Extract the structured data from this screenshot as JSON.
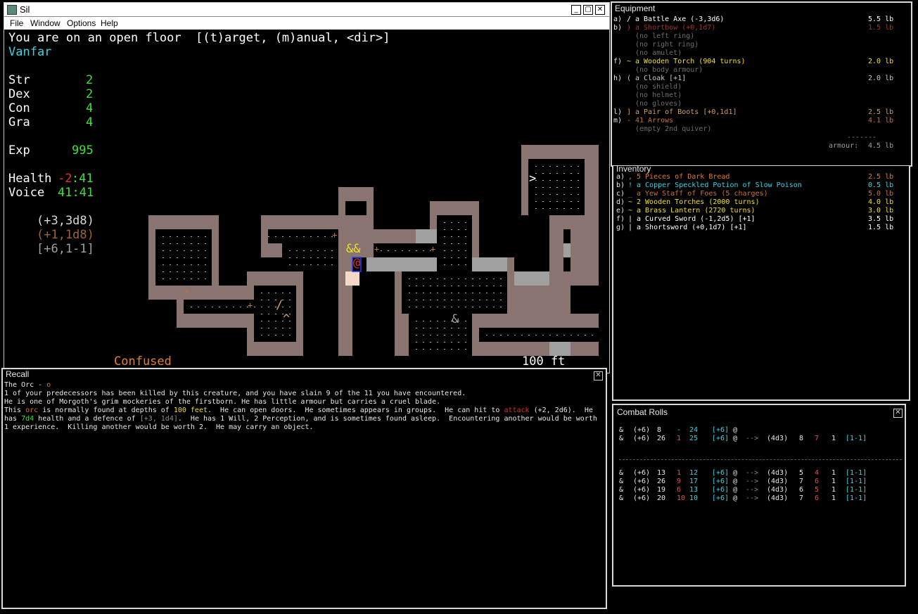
{
  "main_window": {
    "title": "Sil",
    "menu": [
      "File",
      "Window",
      "Options",
      "Help"
    ],
    "prompt": "You are on an open floor  [(t)arget, (m)anual, <dir>]",
    "character_name": "Vanfar",
    "stats": [
      {
        "label": "Str",
        "value": "2"
      },
      {
        "label": "Dex",
        "value": "2"
      },
      {
        "label": "Con",
        "value": "4"
      },
      {
        "label": "Gra",
        "value": "4"
      }
    ],
    "exp_label": "Exp",
    "exp_value": "995",
    "health_label": "Health",
    "health_current": "-2",
    "health_sep_max": ":41",
    "voice_label": "Voice",
    "voice_value": "41:41",
    "attack_melee": "(+3,3d8)",
    "attack_bow": "(+1,1d8)",
    "defence": "[+6,1-1]",
    "status": "Confused",
    "depth": "100 ft"
  },
  "equipment": {
    "title": "Equipment",
    "rows": [
      {
        "slot": "a)",
        "sym": "/",
        "name": "a Battle Axe (-3,3d6)",
        "weight": "5.5 lb",
        "color": "#ffffff"
      },
      {
        "slot": "b)",
        "sym": ")",
        "name": "a Shortbow (+0,1d7)",
        "weight": "1.5 lb",
        "color": "#9b3a2a"
      },
      {
        "slot": "",
        "sym": "",
        "name": "(no left ring)",
        "weight": "",
        "color": "#6e6e6e"
      },
      {
        "slot": "",
        "sym": "",
        "name": "(no right ring)",
        "weight": "",
        "color": "#6e6e6e"
      },
      {
        "slot": "",
        "sym": "",
        "name": "(no amulet)",
        "weight": "",
        "color": "#6e6e6e"
      },
      {
        "slot": "f)",
        "sym": "~",
        "name": "a Wooden Torch (904 turns)",
        "weight": "2.0 lb",
        "color": "#f0e020"
      },
      {
        "slot": "",
        "sym": "",
        "name": "(no body armour)",
        "weight": "",
        "color": "#6e6e6e"
      },
      {
        "slot": "h)",
        "sym": "(",
        "name": "a Cloak [+1]",
        "weight": "2.0 lb",
        "color": "#c8c8c8"
      },
      {
        "slot": "",
        "sym": "",
        "name": "(no shield)",
        "weight": "",
        "color": "#6e6e6e"
      },
      {
        "slot": "",
        "sym": "",
        "name": "(no helmet)",
        "weight": "",
        "color": "#6e6e6e"
      },
      {
        "slot": "",
        "sym": "",
        "name": "(no gloves)",
        "weight": "",
        "color": "#6e6e6e"
      },
      {
        "slot": "l)",
        "sym": "]",
        "name": "a Pair of Boots [+0,1d1]",
        "weight": "2.5 lb",
        "color": "#c8a070"
      },
      {
        "slot": "m)",
        "sym": "-",
        "name": "41 Arrows",
        "weight": "4.1 lb",
        "color": "#c87040"
      },
      {
        "slot": "",
        "sym": "",
        "name": "(empty 2nd quiver)",
        "weight": "",
        "color": "#6e6e6e"
      }
    ],
    "divider": "-------",
    "armour_label": "armour:",
    "armour_value": "4.5 lb"
  },
  "inventory": {
    "title": "Inventory",
    "rows": [
      {
        "slot": "a)",
        "sym": ",",
        "name": "5 Pieces of Dark Bread",
        "weight": "2.5 lb",
        "color": "#e07a30"
      },
      {
        "slot": "b)",
        "sym": "!",
        "name": "a Copper Speckled Potion of Slow Poison",
        "weight": "0.5 lb",
        "color": "#40d0e0"
      },
      {
        "slot": "c)",
        "sym": "_",
        "name": "a Yew Staff of Foes (5 charges)",
        "weight": "5.0 lb",
        "color": "#c87040"
      },
      {
        "slot": "d)",
        "sym": "~",
        "name": "2 Wooden Torches (2000 turns)",
        "weight": "4.0 lb",
        "color": "#f0e020"
      },
      {
        "slot": "e)",
        "sym": "~",
        "name": "a Brass Lantern (2720 turns)",
        "weight": "3.0 lb",
        "color": "#f0e020"
      },
      {
        "slot": "f)",
        "sym": "|",
        "name": "a Curved Sword (-1,2d5) [+1]",
        "weight": "3.5 lb",
        "color": "#ffffff"
      },
      {
        "slot": "g)",
        "sym": "|",
        "name": "a Shortsword (+0,1d7) [+1]",
        "weight": "1.5 lb",
        "color": "#ffffff"
      }
    ]
  },
  "recall": {
    "title": "Recall",
    "heading": "The Orc - ",
    "heading_glyph": "o",
    "line1": "1 of your predecessors has been killed by this creature, and you have slain 9 of the 11 you have encountered.",
    "line2": "He is one of Morgoth's grim mockeries of the firstborn. He has little armour but carries a cruel blade.",
    "line3_a": "This ",
    "line3_orc": "orc",
    "line3_b": " is normally found at depths of ",
    "line3_depth": "100 feet",
    "line3_c": ".  He can open doors.  He sometimes appears in groups.  He can hit to ",
    "line3_attack": "attack",
    "line3_d": " (+2, 2d6).  He",
    "line4_a": "has ",
    "line4_health": "7d4",
    "line4_b": " health and a defence of ",
    "line4_def": "[+3, 1d4]",
    "line4_c": ".  He has 1 Will, 2 Perception, and is sometimes found asleep.  Encountering another would be worth",
    "line5": "1 experience.  Killing another would be worth 2.  He may carry an object."
  },
  "combat": {
    "title": "Combat Rolls",
    "rows_top": [
      [
        "&",
        "(+6)",
        "8",
        "-",
        "24",
        "[+6]",
        "@",
        "",
        "",
        "",
        "",
        "",
        ""
      ],
      [
        "&",
        "(+6)",
        "26",
        "1",
        "25",
        "[+6]",
        "@",
        "-->",
        "(4d3)",
        "8",
        "7",
        "1",
        "[1-1]"
      ]
    ],
    "rows_bottom": [
      [
        "&",
        "(+6)",
        "13",
        "1",
        "12",
        "[+6]",
        "@",
        "-->",
        "(4d3)",
        "5",
        "4",
        "1",
        "[1-1]"
      ],
      [
        "&",
        "(+6)",
        "26",
        "9",
        "17",
        "[+6]",
        "@",
        "-->",
        "(4d3)",
        "7",
        "6",
        "1",
        "[1-1]"
      ],
      [
        "&",
        "(+6)",
        "19",
        "6",
        "13",
        "[+6]",
        "@",
        "-->",
        "(4d3)",
        "6",
        "5",
        "1",
        "[1-1]"
      ],
      [
        "&",
        "(+6)",
        "20",
        "10",
        "10",
        "[+6]",
        "@",
        "-->",
        "(4d3)",
        "7",
        "6",
        "1",
        "[1-1]"
      ]
    ]
  },
  "map_glyphs": {
    "monsters": "&&",
    "player": "@",
    "other_monster": "&",
    "stairs": ">",
    "trap": "^",
    "weapon": "/",
    "door": "+"
  },
  "colors": {
    "wall": "#8a7470",
    "floor_lit": "#a0a0a0",
    "stat_green": "#3ce03c",
    "name_cyan": "#40d0e0",
    "confused_orange": "#e08030",
    "door_orange": "#d07030"
  }
}
